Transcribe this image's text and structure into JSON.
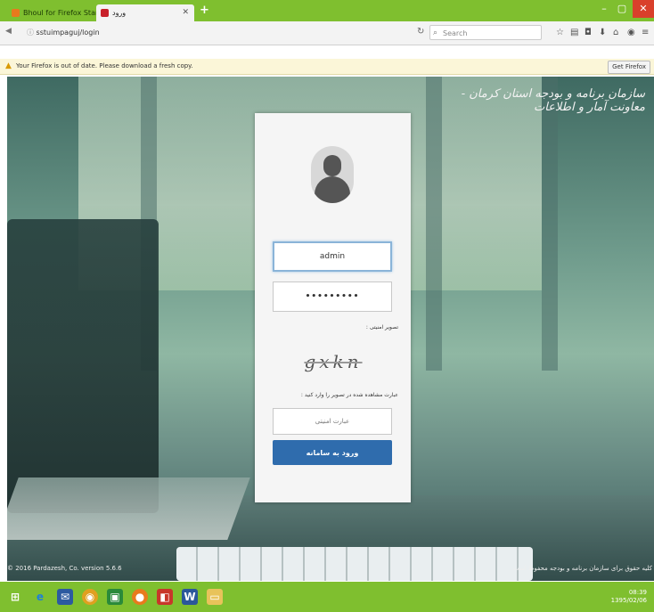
{
  "browser": {
    "tabs": [
      {
        "label": "Bhoul for Firefox Start Page",
        "active": false
      },
      {
        "label": "ورود",
        "active": true
      }
    ],
    "url": "sstuimpaguj/login",
    "search_placeholder": "Search",
    "notification": "Your Firefox is out of date. Please download a fresh copy.",
    "get_firefox_label": "Get Firefox"
  },
  "page": {
    "org_title": "سازمان برنامه و بودجه استان کرمان - معاونت آمار و اطلاعات",
    "copyright": "© 2016 Pardazesh, Co. version 5.6.6",
    "rights": "کلیه حقوق برای سازمان برنامه و بودجه محفوظ است"
  },
  "login": {
    "username_value": "admin",
    "password_value": "•••••••••",
    "captcha_label": "تصویر امنیتی :",
    "captcha_text": "gxkn",
    "enter_label": "عبارت مشاهده شده در تصویر را وارد کنید :",
    "captcha_placeholder": "عبارت امنیتی",
    "login_button": "ورود به سامانه"
  },
  "taskbar": {
    "apps": [
      "windows",
      "ie",
      "mail",
      "chrome",
      "store",
      "firefox",
      "office",
      "word",
      "explorer"
    ],
    "clock_time": "08:39",
    "clock_date": "1395/02/06"
  },
  "colors": {
    "firefox_green": "#7fbf2f",
    "login_button": "#2f6cad",
    "close_red": "#d9402b"
  }
}
